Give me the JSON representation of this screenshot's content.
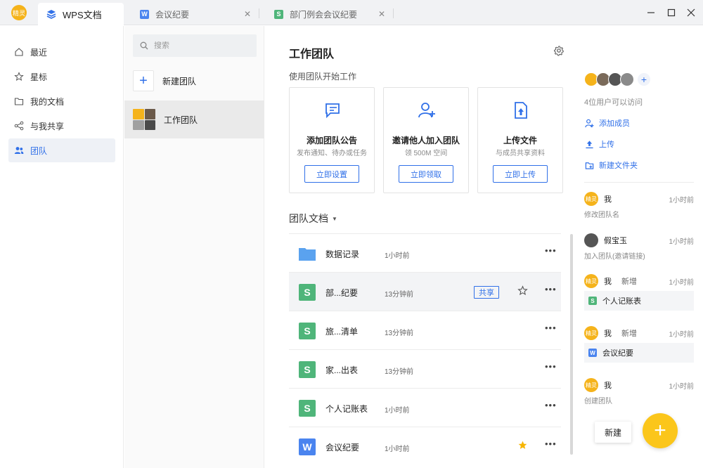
{
  "user": {
    "avatar_text": "精灵"
  },
  "tabs": [
    {
      "label": "WPS文档",
      "icon": "wps-docs-icon"
    },
    {
      "label": "会议纪要",
      "icon": "wps-writer-icon"
    },
    {
      "label": "部门例会会议纪要",
      "icon": "wps-sheet-icon"
    }
  ],
  "window_controls": {
    "minimize": "—",
    "maximize": "☐",
    "close": "✕"
  },
  "nav": {
    "items": [
      {
        "label": "最近",
        "icon": "home-icon"
      },
      {
        "label": "星标",
        "icon": "star-icon"
      },
      {
        "label": "我的文档",
        "icon": "folder-icon"
      },
      {
        "label": "与我共享",
        "icon": "share-icon"
      },
      {
        "label": "团队",
        "icon": "team-icon"
      }
    ],
    "active_index": 4
  },
  "teams": {
    "search_placeholder": "搜索",
    "new_team_label": "新建团队",
    "items": [
      {
        "label": "工作团队"
      }
    ]
  },
  "main": {
    "title": "工作团队",
    "subtitle": "使用团队开始工作",
    "cards": [
      {
        "title": "添加团队公告",
        "desc": "发布通知、待办或任务",
        "button": "立即设置",
        "icon": "announcement-icon"
      },
      {
        "title": "邀请他人加入团队",
        "desc": "领 500M 空间",
        "button": "立即领取",
        "icon": "invite-user-icon"
      },
      {
        "title": "上传文件",
        "desc": "与成员共享资料",
        "button": "立即上传",
        "icon": "upload-file-icon"
      }
    ],
    "docs_title": "团队文档",
    "docs": [
      {
        "name": "数据记录",
        "time": "1小时前",
        "type": "folder",
        "starred": false,
        "shared": false
      },
      {
        "name": "部...纪要",
        "time": "13分钟前",
        "type": "sheet",
        "starred": false,
        "shared": true,
        "share_label": "共享"
      },
      {
        "name": "旅...清单",
        "time": "13分钟前",
        "type": "sheet",
        "starred": false,
        "shared": false
      },
      {
        "name": "家...出表",
        "time": "13分钟前",
        "type": "sheet",
        "starred": false,
        "shared": false
      },
      {
        "name": "个人记账表",
        "time": "1小时前",
        "type": "sheet",
        "starred": false,
        "shared": false
      },
      {
        "name": "会议纪要",
        "time": "1小时前",
        "type": "writer",
        "starred": true,
        "shared": false
      }
    ]
  },
  "right": {
    "access_text": "4位用户可以访问",
    "actions": [
      {
        "label": "添加成员",
        "icon": "add-member-icon"
      },
      {
        "label": "上传",
        "icon": "upload-icon"
      },
      {
        "label": "新建文件夹",
        "icon": "new-folder-icon"
      }
    ],
    "activity": [
      {
        "who": "我",
        "verb": "",
        "time": "1小时前",
        "desc": "修改团队名",
        "file": "",
        "avatar": "精灵"
      },
      {
        "who": "假宝玉",
        "verb": "",
        "time": "1小时前",
        "desc": "加入团队(邀请链接)",
        "file": "",
        "avatar": ""
      },
      {
        "who": "我",
        "verb": "新增",
        "time": "1小时前",
        "desc": "",
        "file": "个人记账表",
        "file_type": "sheet",
        "avatar": "精灵"
      },
      {
        "who": "我",
        "verb": "新增",
        "time": "1小时前",
        "desc": "",
        "file": "会议纪要",
        "file_type": "writer",
        "avatar": "精灵"
      },
      {
        "who": "我",
        "verb": "",
        "time": "1小时前",
        "desc": "创建团队",
        "file": "",
        "avatar": "精灵"
      }
    ],
    "new_button": "新建",
    "fab_label": "+"
  },
  "colors": {
    "accent": "#3070e8",
    "sheet": "#4fb57a",
    "writer": "#4a84ef",
    "folder": "#5aa2ef",
    "fab": "#fbc61b",
    "star": "#f7b500"
  }
}
